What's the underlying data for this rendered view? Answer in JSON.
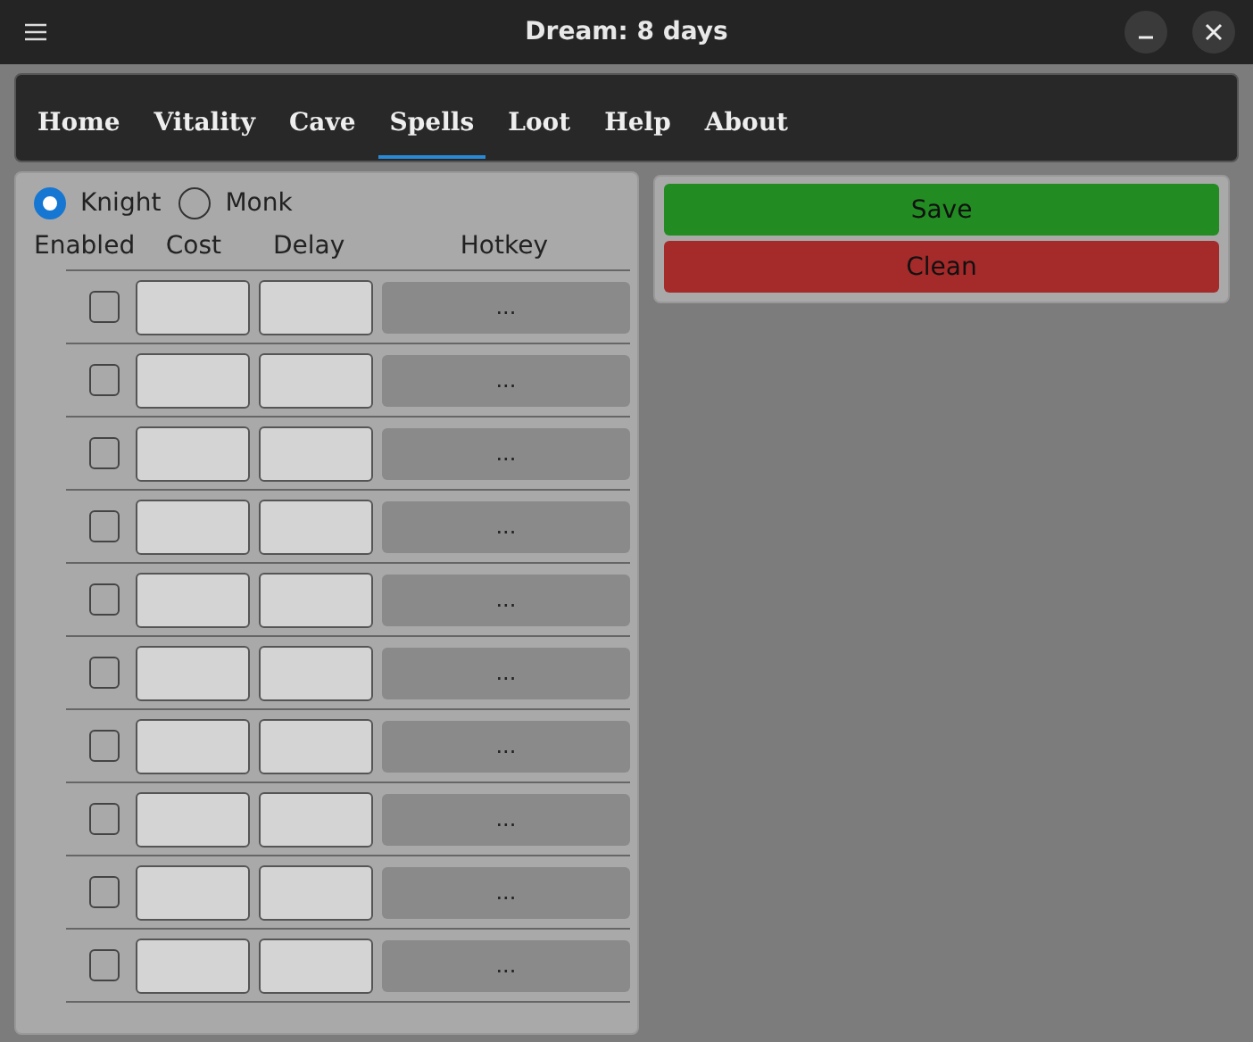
{
  "window": {
    "title": "Dream: 8 days"
  },
  "tabs": [
    {
      "label": "Home",
      "selected": false
    },
    {
      "label": "Vitality",
      "selected": false
    },
    {
      "label": "Cave",
      "selected": false
    },
    {
      "label": "Spells",
      "selected": true
    },
    {
      "label": "Loot",
      "selected": false
    },
    {
      "label": "Help",
      "selected": false
    },
    {
      "label": "About",
      "selected": false
    }
  ],
  "vocations": [
    {
      "label": "Knight",
      "selected": true
    },
    {
      "label": "Monk",
      "selected": false
    }
  ],
  "columns": [
    "Enabled",
    "Cost",
    "Delay",
    "Hotkey"
  ],
  "rows": [
    {
      "checked": false,
      "hotkey": "..."
    },
    {
      "checked": false,
      "hotkey": "..."
    },
    {
      "checked": false,
      "hotkey": "..."
    },
    {
      "checked": false,
      "hotkey": "..."
    },
    {
      "checked": false,
      "hotkey": "..."
    },
    {
      "checked": false,
      "hotkey": "..."
    },
    {
      "checked": false,
      "hotkey": "..."
    },
    {
      "checked": false,
      "hotkey": "..."
    },
    {
      "checked": false,
      "hotkey": "..."
    },
    {
      "checked": false,
      "hotkey": "..."
    }
  ],
  "actions": [
    {
      "label": "Save",
      "color": "#228b22"
    },
    {
      "label": "Clean",
      "color": "#a52a2a"
    }
  ]
}
